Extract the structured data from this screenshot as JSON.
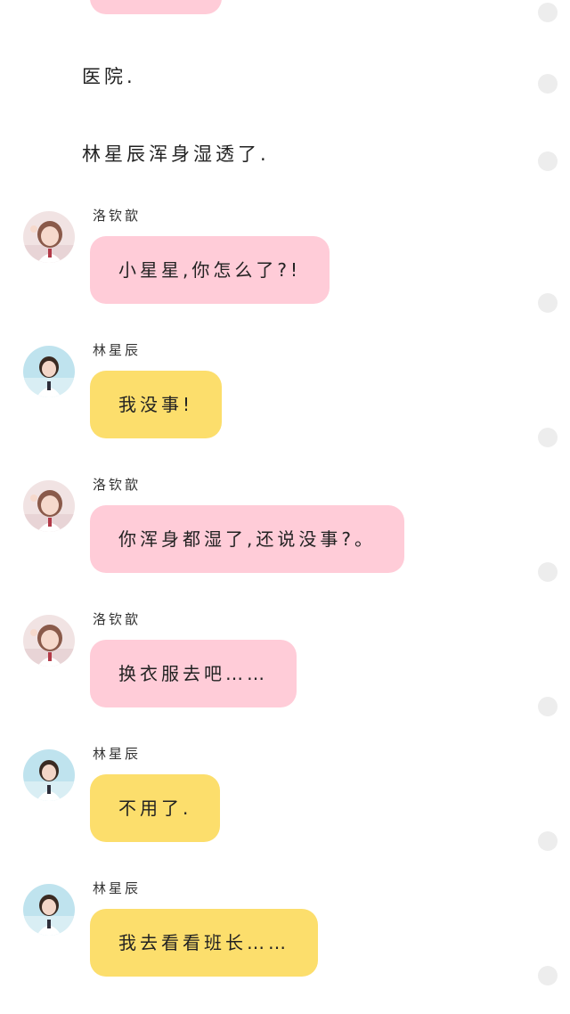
{
  "narration": [
    {
      "text": "医院."
    },
    {
      "text": "林星辰浑身湿透了."
    }
  ],
  "messages": [
    {
      "sender": "洛钦歆",
      "text": "小星星,你怎么了?!",
      "bubble_color": "pink",
      "avatar": "girl-pink-avatar"
    },
    {
      "sender": "林星辰",
      "text": "我没事!",
      "bubble_color": "yellow",
      "avatar": "girl-blue-avatar"
    },
    {
      "sender": "洛钦歆",
      "text": "你浑身都湿了,还说没事?。",
      "bubble_color": "pink",
      "avatar": "girl-pink-avatar"
    },
    {
      "sender": "洛钦歆",
      "text": "换衣服去吧……",
      "bubble_color": "pink",
      "avatar": "girl-pink-avatar"
    },
    {
      "sender": "林星辰",
      "text": "不用了.",
      "bubble_color": "yellow",
      "avatar": "girl-blue-avatar"
    },
    {
      "sender": "林星辰",
      "text": "我去看看班长……",
      "bubble_color": "yellow",
      "avatar": "girl-blue-avatar"
    }
  ],
  "colors": {
    "pink_bubble": "#FFCCD8",
    "yellow_bubble": "#FCDE6C",
    "scroll_dot": "#EDEDED"
  }
}
